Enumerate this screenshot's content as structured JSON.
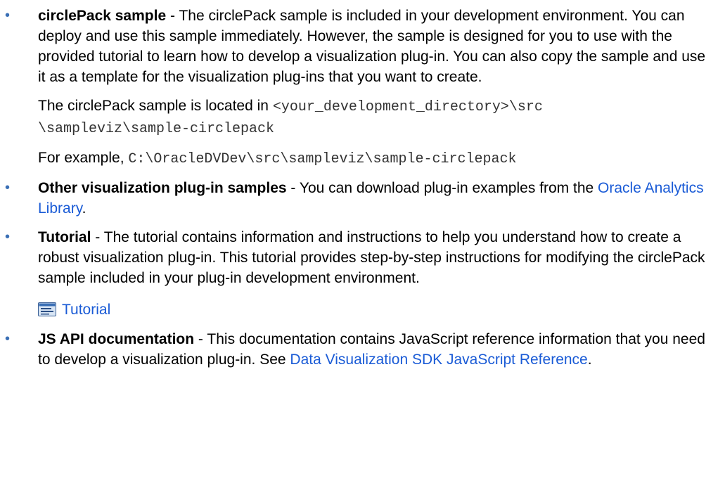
{
  "items": [
    {
      "term": "circlePack sample",
      "sep": " - ",
      "text": "The circlePack sample is included in your development environment. You can deploy and use this sample immediately. However, the sample is designed for you to use with the provided tutorial to learn how to develop a visualization plug-in. You can also copy the sample and use it as a template for the visualization plug-ins that you want to create.",
      "location_prefix": "The circlePack sample is located in ",
      "location_code_1": "<your_development_directory>\\src",
      "location_code_2": "\\sampleviz\\sample-circlepack",
      "example_prefix": "For example, ",
      "example_code": "C:\\OracleDVDev\\src\\sampleviz\\sample-circlepack"
    },
    {
      "term": "Other visualization plug-in samples",
      "sep": " - ",
      "text": "You can download plug-in examples from the ",
      "link": "Oracle Analytics Library",
      "suffix": "."
    },
    {
      "term": "Tutorial",
      "sep": " - ",
      "text": "The tutorial contains information and instructions to help you understand how to create a robust visualization plug-in. This tutorial provides step-by-step instructions for modifying the circlePack sample included in your plug-in development environment.",
      "tutorial_link": "Tutorial",
      "tutorial_icon": "tutorial-book-icon"
    },
    {
      "term": "JS API documentation",
      "sep": " - ",
      "text": "This documentation contains JavaScript reference information that you need to develop a visualization plug-in. See ",
      "link": "Data Visualization SDK JavaScript Reference",
      "suffix": "."
    }
  ],
  "colors": {
    "bullet": "#3a6fb5",
    "link": "#1a5bd6"
  }
}
